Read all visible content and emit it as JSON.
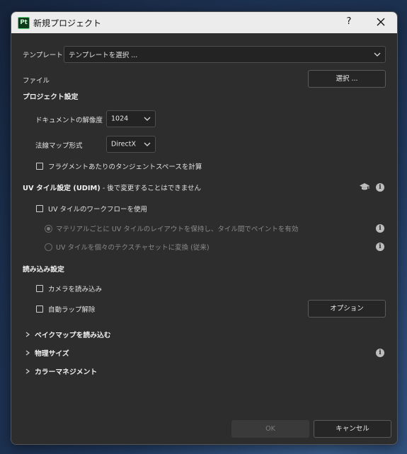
{
  "titlebar": {
    "app_icon_text": "Pt",
    "title": "新規プロジェクト",
    "help": "?",
    "close_icon": "close-icon"
  },
  "template": {
    "label": "テンプレート",
    "value": "テンプレートを選択 ..."
  },
  "file": {
    "label": "ファイル",
    "select_button": "選択 ..."
  },
  "project_settings": {
    "heading": "プロジェクト設定",
    "doc_resolution_label": "ドキュメントの解像度",
    "doc_resolution_value": "1024",
    "normal_map_label": "法線マップ形式",
    "normal_map_value": "DirectX",
    "tangent_checkbox_label": "フラグメントあたりのタンジェントスペースを計算",
    "tangent_checked": false
  },
  "udim": {
    "heading": "UV タイル設定 (UDIM)",
    "heading_note": "- 後で変更することはできません",
    "workflow_checkbox_label": "UV タイルのワークフローを使用",
    "workflow_checked": false,
    "radio_option_1": "マテリアルごとに UV タイルのレイアウトを保持し、タイル間でペイントを有効",
    "radio_option_1_selected": true,
    "radio_option_2": "UV タイルを個々のテクスチャセットに変換 (従来)",
    "radio_option_2_selected": false
  },
  "import_settings": {
    "heading": "読み込み設定",
    "camera_checkbox_label": "カメラを読み込み",
    "camera_checked": false,
    "auto_unwrap_label": "自動ラップ解除",
    "auto_unwrap_checked": false,
    "options_button": "オプション"
  },
  "expanders": {
    "bake_maps": "ベイクマップを読み込む",
    "physical_size": "物理サイズ",
    "color_management": "カラーマネジメント"
  },
  "footer": {
    "ok_button": "OK",
    "cancel_button": "キャンセル"
  },
  "colors": {
    "dialog_bg": "#2d2d2d",
    "titlebar_bg": "#ececec",
    "control_bg": "#232323"
  }
}
